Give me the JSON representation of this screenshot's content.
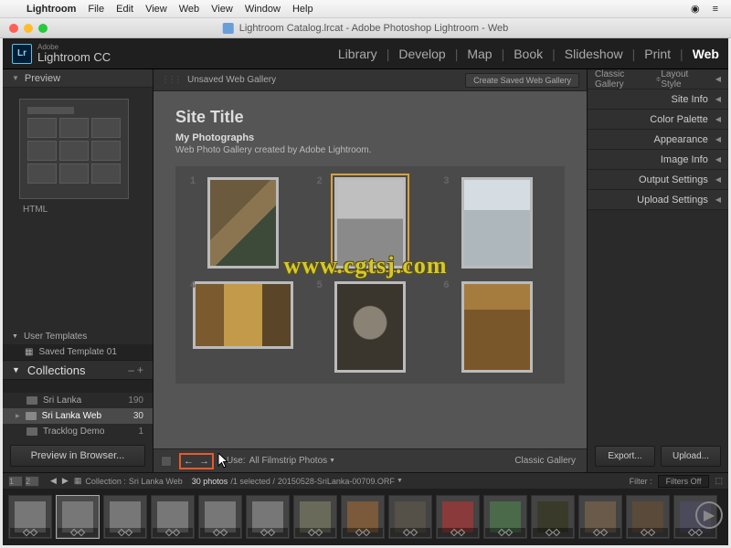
{
  "menubar": {
    "app": "Lightroom",
    "items": [
      "File",
      "Edit",
      "View",
      "Web",
      "View",
      "Window",
      "Help"
    ]
  },
  "window": {
    "title": "Lightroom Catalog.lrcat - Adobe Photoshop Lightroom - Web"
  },
  "header": {
    "brand_small": "Adobe",
    "brand": "Lightroom CC",
    "modules": [
      "Library",
      "Develop",
      "Map",
      "Book",
      "Slideshow",
      "Print",
      "Web"
    ],
    "active_module": "Web"
  },
  "left": {
    "preview_title": "Preview",
    "preview_format": "HTML",
    "user_templates_label": "User Templates",
    "saved_template": "Saved Template 01",
    "collections_title": "Collections",
    "items": [
      {
        "name": "Sri Lanka",
        "count": "190"
      },
      {
        "name": "Sri Lanka Web",
        "count": "30"
      },
      {
        "name": "Tracklog Demo",
        "count": "1"
      }
    ],
    "preview_btn": "Preview in Browser..."
  },
  "center": {
    "unsaved_label": "Unsaved Web Gallery",
    "create_btn": "Create Saved Web Gallery",
    "site_title": "Site Title",
    "collection_title": "My Photographs",
    "collection_desc": "Web Photo Gallery created by Adobe Lightroom.",
    "thumbs": [
      "1",
      "2",
      "3",
      "4",
      "5",
      "6"
    ],
    "use_label": "Use:",
    "use_value": "All Filmstrip Photos",
    "engine_label": "Classic Gallery"
  },
  "right": {
    "engine": "Classic Gallery",
    "layout_label": "Layout Style",
    "rows": [
      "Site Info",
      "Color Palette",
      "Appearance",
      "Image Info",
      "Output Settings",
      "Upload Settings"
    ],
    "export_btn": "Export...",
    "upload_btn": "Upload..."
  },
  "filmstrip": {
    "crumb_prefix": "Collection :",
    "crumb_name": "Sri Lanka Web",
    "count": "30 photos",
    "selection": "/1 selected /",
    "filename": "20150528-SriLanka-00709.ORF",
    "filter_label": "Filter :",
    "filter_value": "Filters Off"
  },
  "watermark": "www.cgtsj.com"
}
